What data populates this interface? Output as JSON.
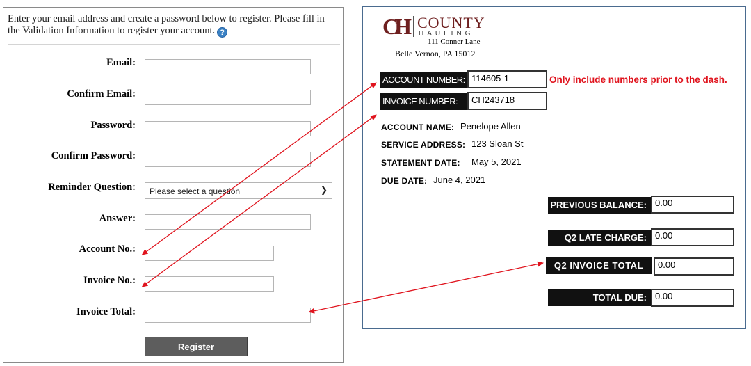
{
  "form": {
    "intro": "Enter your email address and create a password below to register. Please fill in the Validation Information to register your account.",
    "help_icon": "question-circle-icon",
    "fields": {
      "email": {
        "label": "Email:",
        "value": ""
      },
      "confirm_email": {
        "label": "Confirm Email:",
        "value": ""
      },
      "password": {
        "label": "Password:",
        "value": ""
      },
      "confirm_password": {
        "label": "Confirm Password:",
        "value": ""
      },
      "reminder_question": {
        "label": "Reminder Question:",
        "selected": "Please select a question"
      },
      "answer": {
        "label": "Answer:",
        "value": ""
      },
      "account_no": {
        "label": "Account No.:",
        "value": ""
      },
      "invoice_no": {
        "label": "Invoice No.:",
        "value": ""
      },
      "invoice_total": {
        "label": "Invoice Total:",
        "value": ""
      }
    },
    "register_label": "Register"
  },
  "invoice": {
    "logo_mark": "CH",
    "logo_name": "COUNTY",
    "logo_sub": "HAULING",
    "address_line1": "111 Conner Lane",
    "address_line2": "Belle Vernon, PA 15012",
    "account_number": {
      "label": "ACCOUNT NUMBER:",
      "value": "114605-1"
    },
    "invoice_number": {
      "label": "INVOICE NUMBER:",
      "value": "CH243718"
    },
    "note": "Only include numbers prior to the dash.",
    "account_name": {
      "label": "ACCOUNT NAME:",
      "value": "Penelope Allen"
    },
    "service_address": {
      "label": "SERVICE ADDRESS:",
      "value": "123 Sloan St"
    },
    "statement_date": {
      "label": "STATEMENT DATE:",
      "value": "May 5, 2021"
    },
    "due_date": {
      "label": "DUE DATE:",
      "value": "June 4, 2021"
    },
    "previous_balance": {
      "label": "PREVIOUS BALANCE:",
      "value": "0.00"
    },
    "late_charge": {
      "label": "Q2 LATE CHARGE:",
      "value": "0.00"
    },
    "invoice_total": {
      "label": "Q2 INVOICE TOTAL",
      "value": "0.00"
    },
    "total_due": {
      "label": "TOTAL DUE:",
      "value": "0.00"
    }
  },
  "colors": {
    "arrow": "#e0141e",
    "note": "#e0141e",
    "brand": "#6e1f1f",
    "panel_border": "#4a6b8f"
  }
}
